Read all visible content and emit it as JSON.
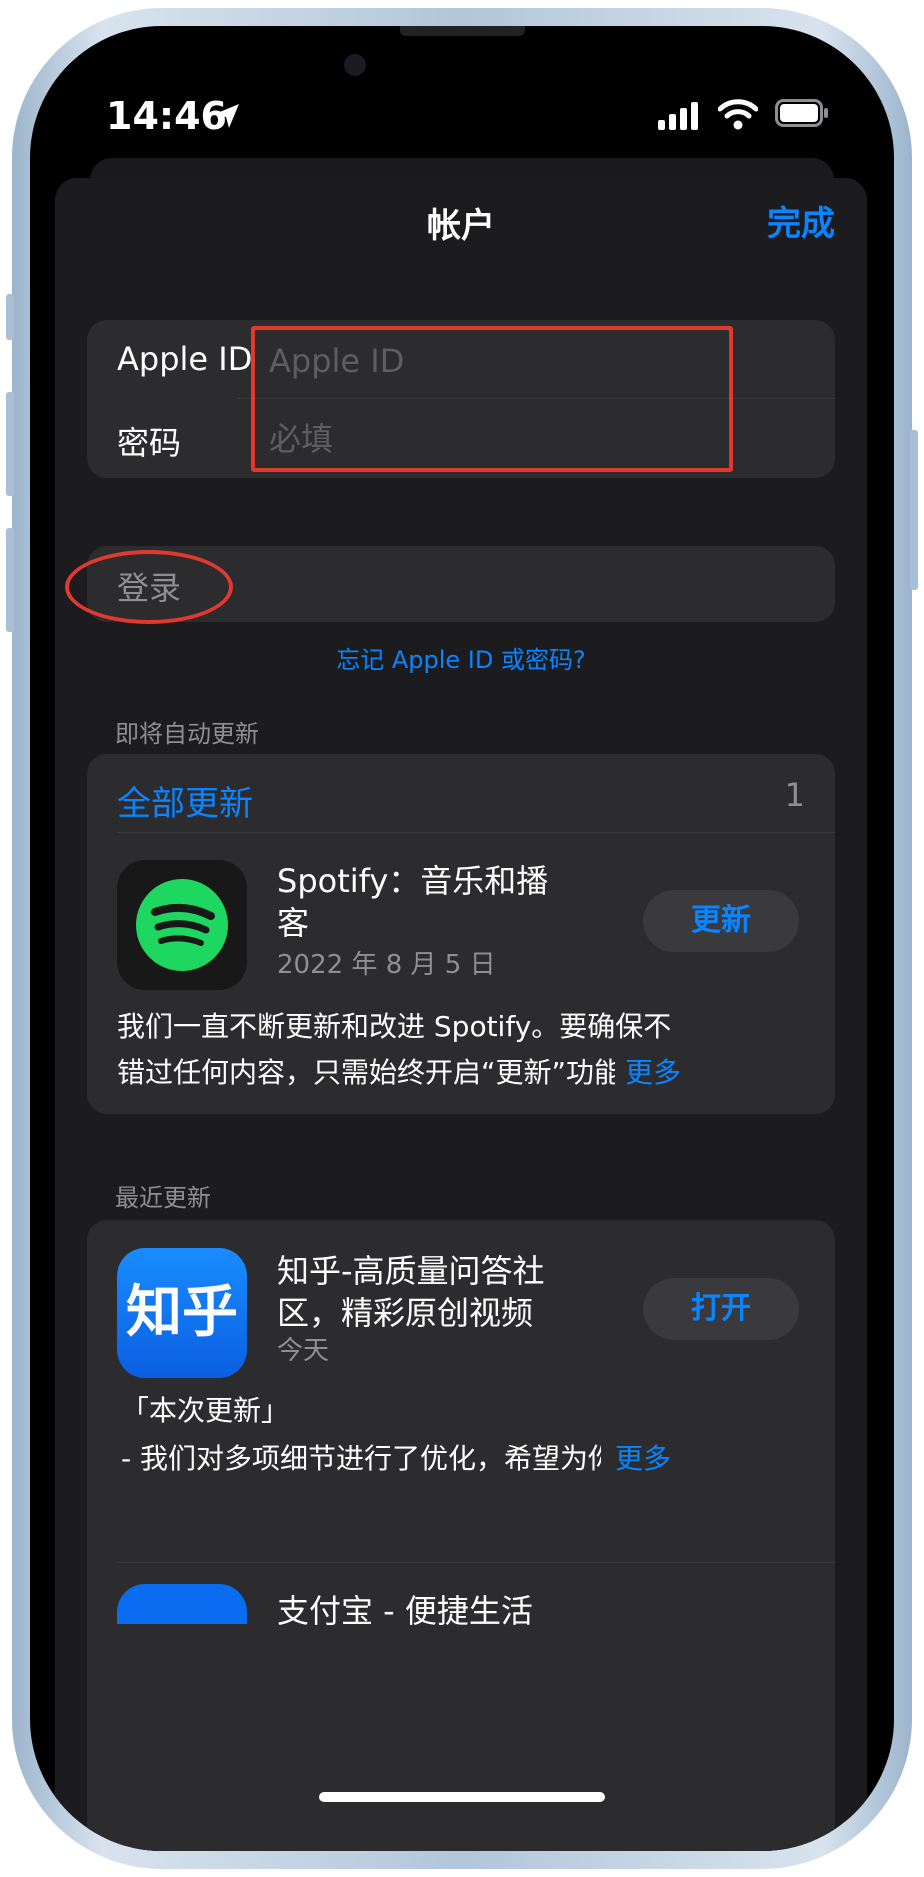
{
  "status_bar": {
    "time": "14:46"
  },
  "nav": {
    "title": "帐户",
    "done_label": "完成"
  },
  "login": {
    "apple_id_label": "Apple ID",
    "apple_id_placeholder": "Apple ID",
    "password_label": "密码",
    "password_placeholder": "必填",
    "sign_in_label": "登录",
    "forgot_link": "忘记 Apple ID 或密码?"
  },
  "pending_updates": {
    "section_title": "即将自动更新",
    "update_all_label": "全部更新",
    "count": "1",
    "app": {
      "icon": "spotify-icon",
      "name": "Spotify：音乐和播客",
      "date": "2022 年 8 月 5 日",
      "button_label": "更新",
      "notes_line1": "我们一直不断更新和改进 Spotify。要确保不",
      "notes_line2": "错过任何内容，只需始终开启“更新”功能",
      "more_label": "更多"
    }
  },
  "recent_updates": {
    "section_title": "最近更新",
    "app": {
      "icon_text": "知乎",
      "name": "知乎-高质量问答社区，精彩原创视频",
      "date": "今天",
      "button_label": "打开",
      "notes_line1": "「本次更新」",
      "notes_line2": " - 我们对多项细节进行了优化，希望为你",
      "more_label": "更多"
    },
    "next_app_name": "支付宝 - 便捷生活"
  },
  "colors": {
    "accent": "#0a84ff",
    "background": "#1c1c1e",
    "card": "#2c2c2e",
    "annotation": "#e0392e",
    "spotify_green": "#1ed760"
  }
}
